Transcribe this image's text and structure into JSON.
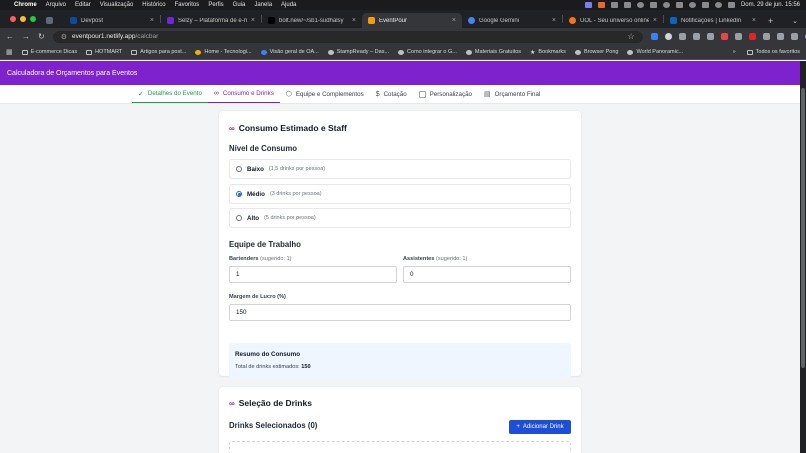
{
  "menubar": {
    "app": "Chrome",
    "items": [
      "Arquivo",
      "Editar",
      "Visualização",
      "Histórico",
      "Favoritos",
      "Perfis",
      "Guia",
      "Janela",
      "Ajuda"
    ],
    "datetime": "Dom. 29 de jun.  15:56"
  },
  "tabs": [
    {
      "title": "Devpost",
      "color": "#0b4a9e",
      "active": false
    },
    {
      "title": "Selzy – Plataforma de e-mail",
      "color": "#6d28d9",
      "active": false
    },
    {
      "title": "bolt.new/~/sb1-sudhalsy",
      "color": "#000000",
      "active": false
    },
    {
      "title": "EventPour",
      "color": "#f59e0b",
      "active": true
    },
    {
      "title": "Google Gemini",
      "color": "#4285f4",
      "active": false
    },
    {
      "title": "UOL - Seu universo online",
      "color": "#f97316",
      "active": false
    },
    {
      "title": "Notificações | LinkedIn",
      "color": "#0a66c2",
      "active": false
    }
  ],
  "toolbar": {
    "url_host": "eventpour1.netlify.app",
    "url_path": "/calcbar"
  },
  "bookmarks": {
    "items": [
      "E-commerce Dicas",
      "HOTMART",
      "Artigos para post...",
      "Home - Tecnologi...",
      "Visão geral de OA...",
      "StampReady – Das...",
      "Como integrar o G...",
      "Materiais Gratuitos",
      "Bookmarks",
      "Browser Pong",
      "World Panoramic..."
    ],
    "more": "»",
    "all_label": "Todos os favoritos"
  },
  "app": {
    "title": "Calculadora de Orçamentos para Eventos",
    "accent": "#7e22ce",
    "steps": [
      {
        "label": "Detalhes do Evento",
        "icon": "✓",
        "state": "done"
      },
      {
        "label": "Consumo e Drinks",
        "icon": "⌘",
        "state": "current"
      },
      {
        "label": "Equipe e Complementos",
        "icon": "⬡",
        "state": "todo"
      },
      {
        "label": "Cotação",
        "icon": "$",
        "state": "todo"
      },
      {
        "label": "Personalização",
        "icon": "□",
        "state": "todo"
      },
      {
        "label": "Orçamento Final",
        "icon": "▤",
        "state": "todo"
      }
    ]
  },
  "consumo_card": {
    "title": "Consumo Estimado e Staff",
    "nivel_title": "Nível de Consumo",
    "options": [
      {
        "label": "Baixo",
        "sub": "(1,5 drinks por pessoa)",
        "selected": false
      },
      {
        "label": "Médio",
        "sub": "(3 drinks por pessoa)",
        "selected": true
      },
      {
        "label": "Alto",
        "sub": "(5 drinks por pessoa)",
        "selected": false
      }
    ],
    "equipe_title": "Equipe de Trabalho",
    "bartenders_label": "Bartenders",
    "bartenders_hint": "(sugerido: 1)",
    "bartenders_value": "1",
    "assistentes_label": "Assistentes",
    "assistentes_hint": "(sugerido: 1)",
    "assistentes_value": "0",
    "margem_label": "Margem de Lucro (%)",
    "margem_value": "150",
    "resumo_title": "Resumo do Consumo",
    "resumo_text": "Total de drinks estimados:",
    "resumo_value": "150"
  },
  "drinks_card": {
    "title": "Seleção de Drinks",
    "selected_title": "Drinks Selecionados (0)",
    "add_button": "Adicionar Drink"
  }
}
